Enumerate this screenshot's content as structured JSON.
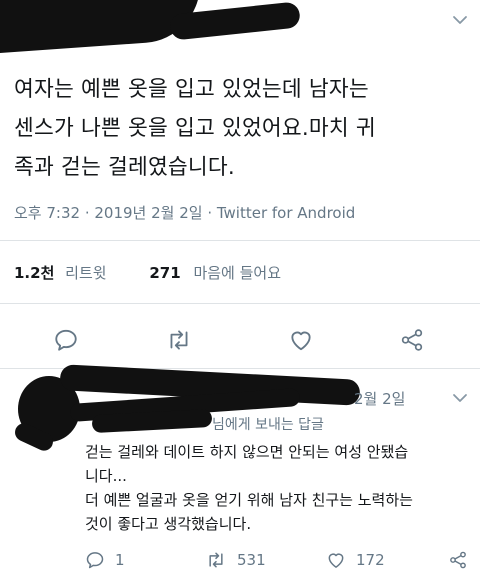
{
  "main_tweet": {
    "text_lines": [
      "여자는 예쁜 옷을 입고 있었는데 남자는",
      "센스가 나쁜 옷을 입고 있었어요.마치 귀",
      "족과 걷는 걸레였습니다."
    ],
    "timestamp": "오후 7:32 · 2019년 2월 2일 · Twitter for Android",
    "retweet_count": "1.2천",
    "retweet_label": "리트윗",
    "like_count": "271",
    "like_label": "마음에 들어요"
  },
  "reply": {
    "date": "2월 2일",
    "reply_to": "님에게 보내는 답글",
    "text_lines": [
      "걷는 걸레와 데이트 하지 않으면 안되는 여성 안됐습",
      "니다...",
      "더 예쁜 얼굴과 옷을 얻기 위해 남자 친구는 노력하는",
      "것이 좋다고 생각했습니다."
    ],
    "reply_count": "1",
    "retweet_count": "531",
    "like_count": "172"
  },
  "icons": {
    "more": "chevron-down-icon",
    "reply": "reply-icon",
    "retweet": "retweet-icon",
    "like": "heart-icon",
    "share": "share-icon"
  }
}
